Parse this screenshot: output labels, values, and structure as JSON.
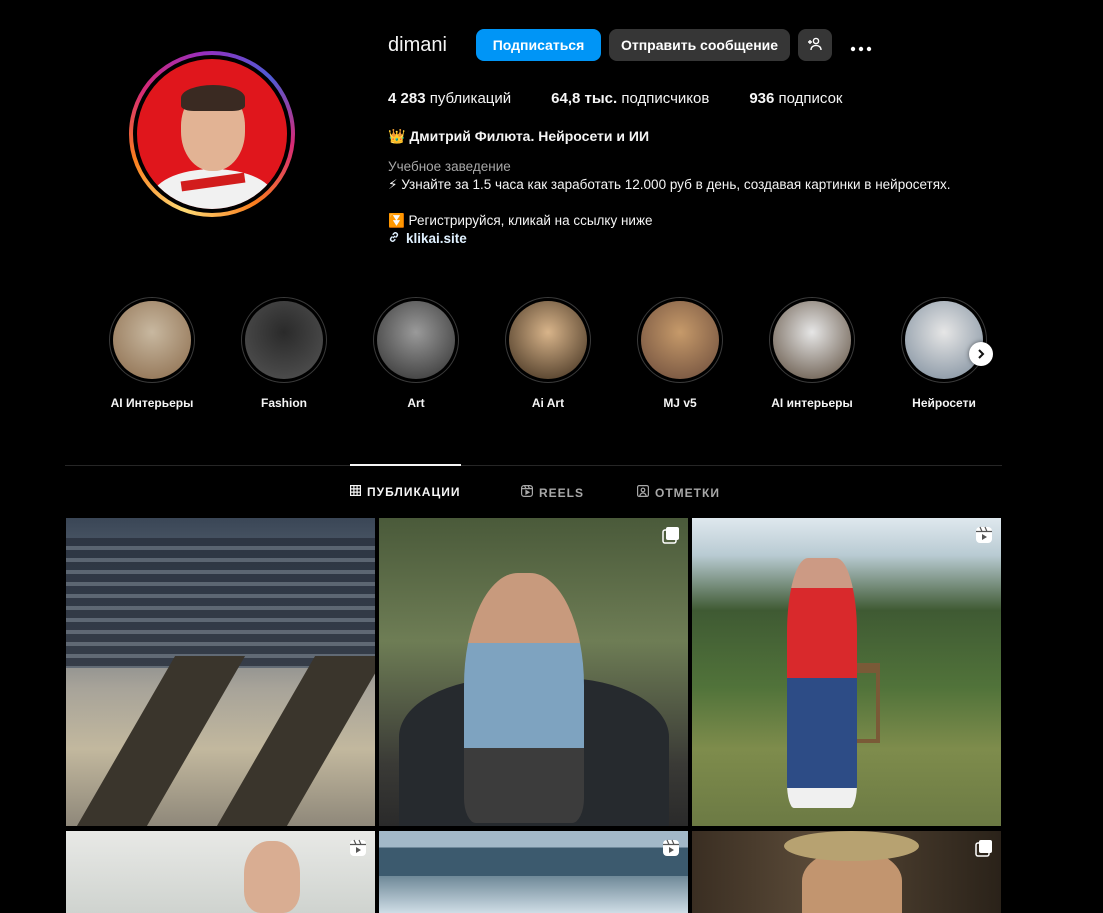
{
  "profile": {
    "username": "dimani",
    "follow_label": "Подписаться",
    "message_label": "Отправить сообщение",
    "add_user_icon": "add-user-icon",
    "more_icon": "more-icon",
    "stats": [
      {
        "value": "4 283",
        "label": "публикаций"
      },
      {
        "value": "64,8 тыс.",
        "label": "подписчиков"
      },
      {
        "value": "936",
        "label": "подписок"
      }
    ],
    "full_name": "👑 Дмитрий Филюта. Нейросети и ИИ",
    "category": "Учебное заведение",
    "bio_line1": "⚡ Узнайте за 1.5 часа как заработать 12.000 руб в день, создавая картинки в нейросетях.",
    "bio_line2": "⏬ Регистрируйся, кликай на ссылку ниже",
    "link": "klikai.site"
  },
  "highlights": [
    {
      "label": "AI Интерьеры",
      "colors": [
        "#c8b8a0",
        "#8a6a4a"
      ]
    },
    {
      "label": "Fashion",
      "colors": [
        "#2a2a2a",
        "#555555"
      ]
    },
    {
      "label": "Art",
      "colors": [
        "#9a9a9a",
        "#2e2e2e"
      ]
    },
    {
      "label": "Ai Art",
      "colors": [
        "#d8b48a",
        "#3a2a1a"
      ]
    },
    {
      "label": "MJ v5",
      "colors": [
        "#c69a6a",
        "#6a4a3a"
      ]
    },
    {
      "label": "AI интерьеры",
      "colors": [
        "#e6e6e6",
        "#5a4a3a"
      ]
    },
    {
      "label": "Нейросети",
      "colors": [
        "#e6e6e6",
        "#7a8a9a"
      ]
    }
  ],
  "tabs": [
    {
      "label": "ПУБЛИКАЦИИ",
      "icon": "grid-icon",
      "active": true
    },
    {
      "label": "REELS",
      "icon": "reels-icon",
      "active": false
    },
    {
      "label": "ОТМЕТКИ",
      "icon": "tagged-icon",
      "active": false
    }
  ],
  "colors": {
    "accent": "#0095f6",
    "secondary_button": "#363636",
    "background": "#000000"
  }
}
